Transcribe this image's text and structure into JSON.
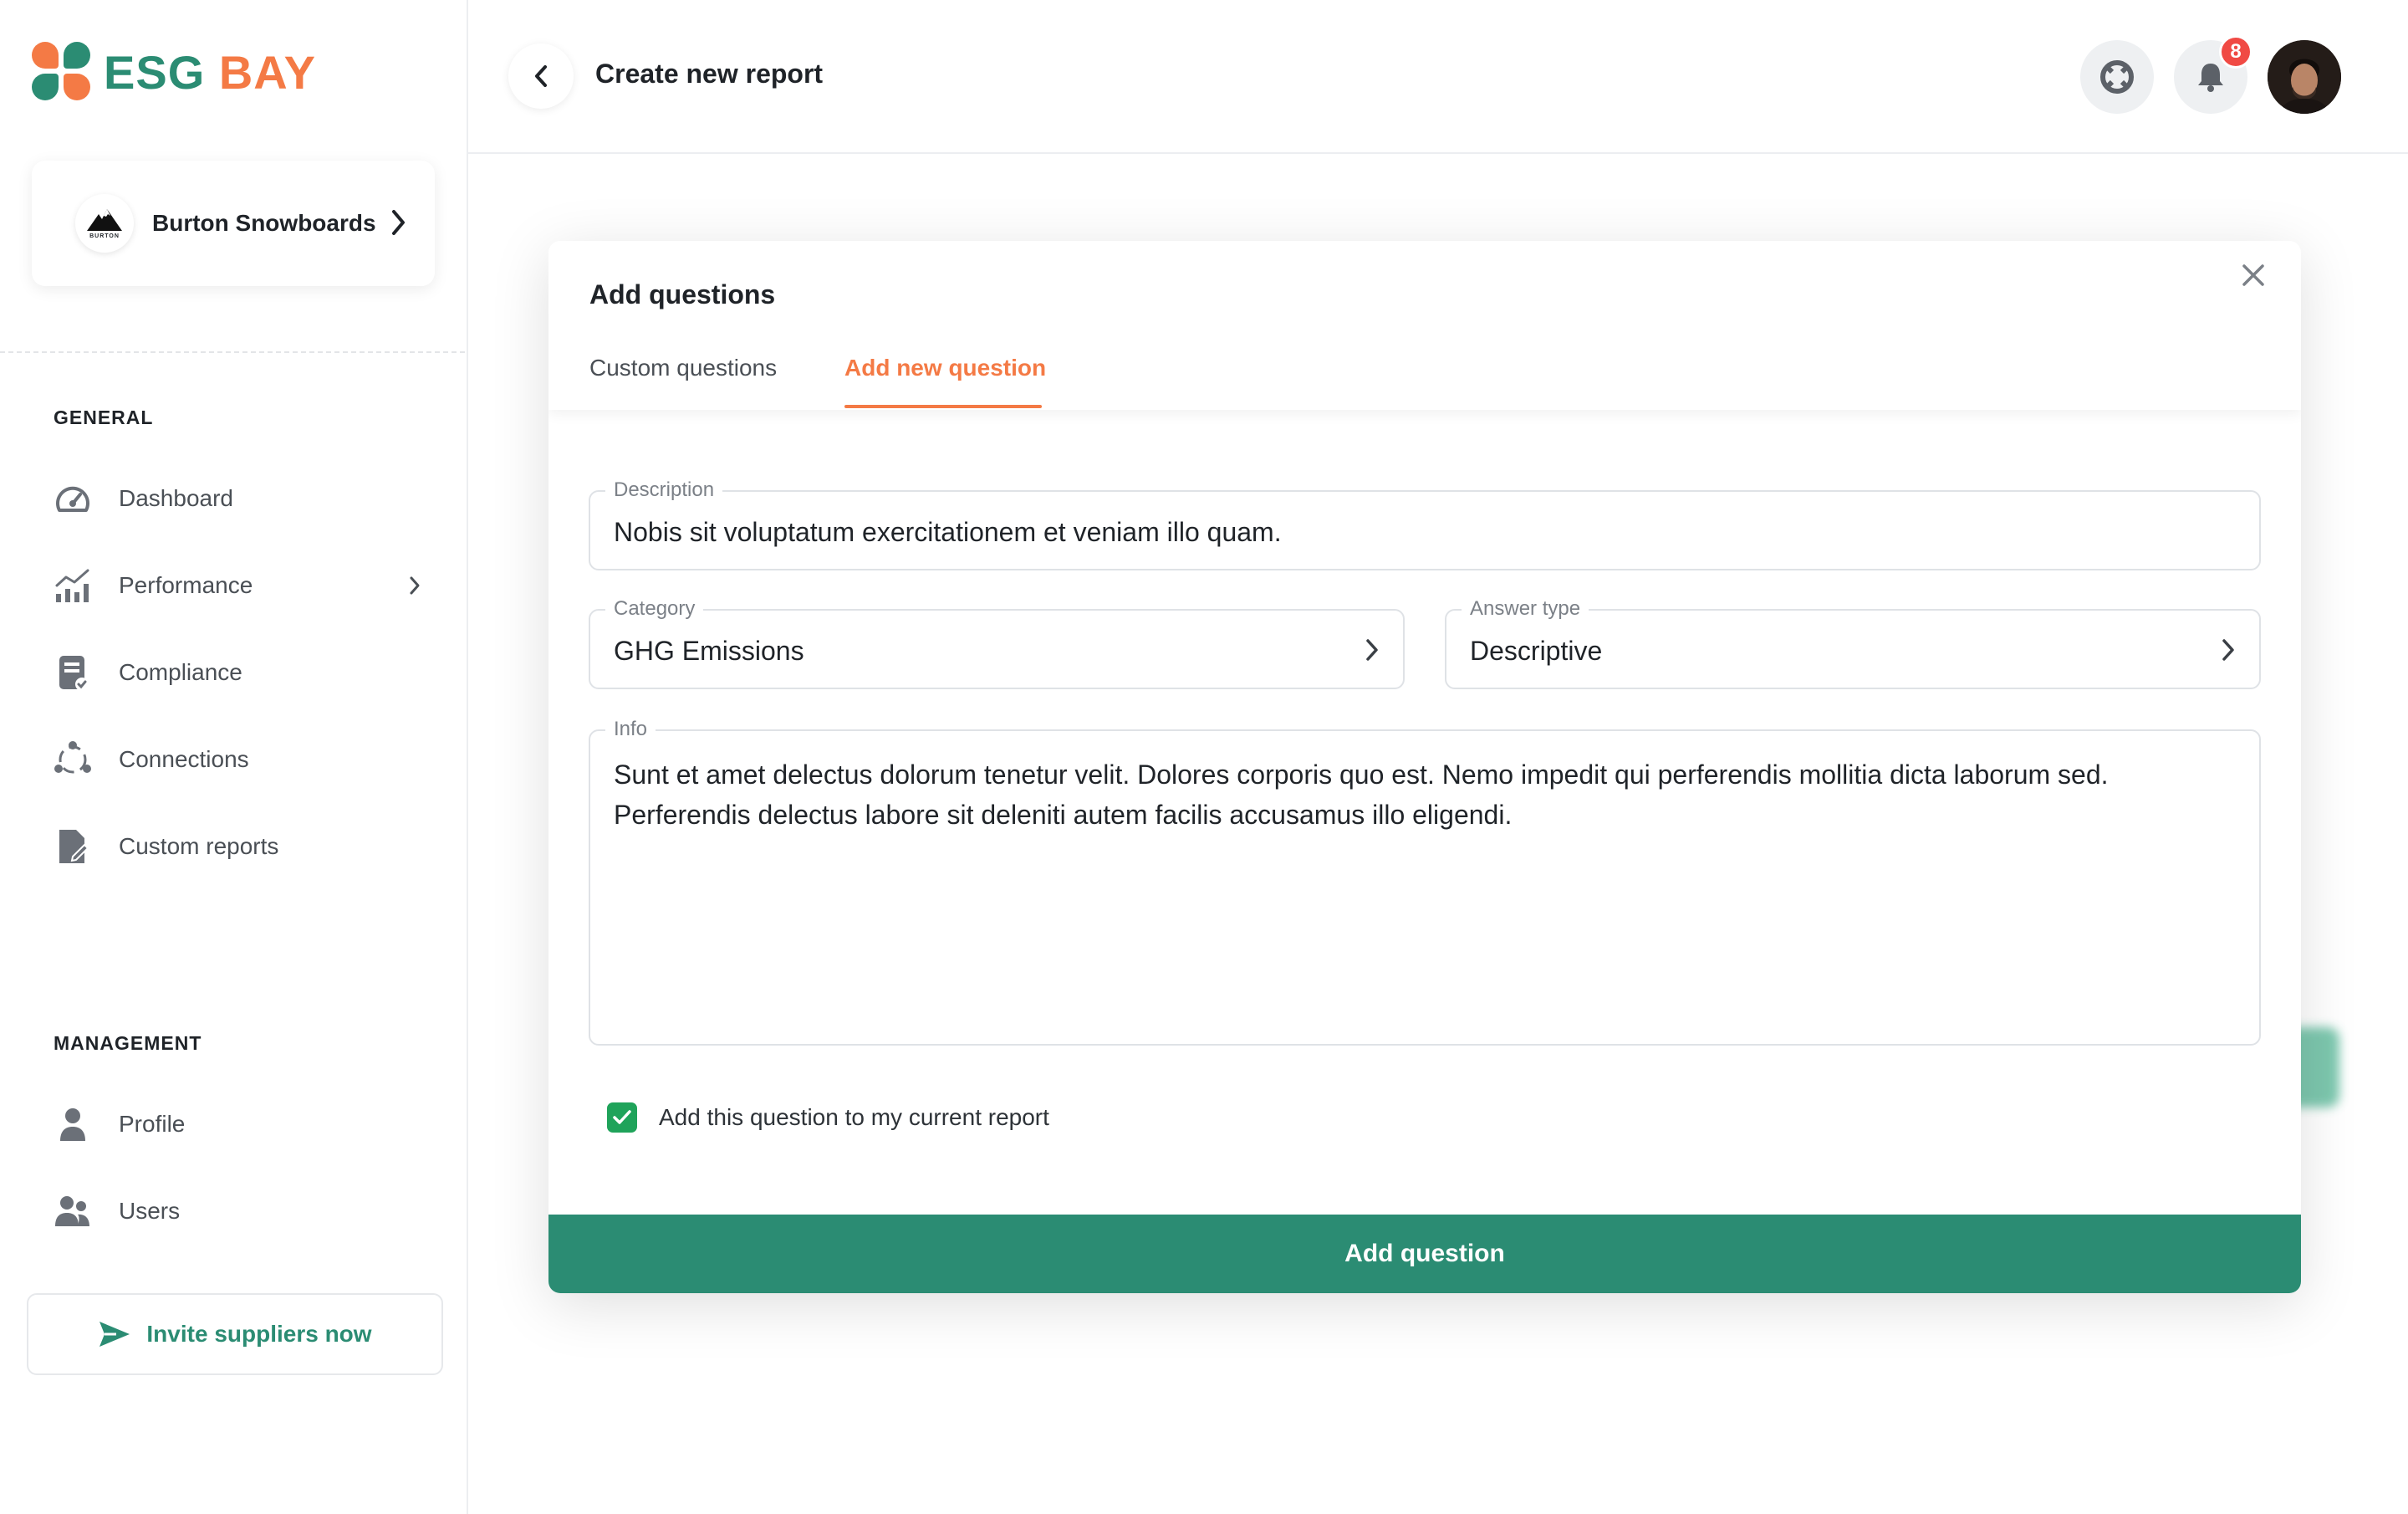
{
  "brand": {
    "part1": "ESG",
    "part2": "BAY"
  },
  "organization": {
    "name": "Burton Snowboards",
    "logo_text": "BURTON"
  },
  "sidebar": {
    "general_title": "GENERAL",
    "general_items": [
      {
        "label": "Dashboard",
        "icon": "gauge-icon"
      },
      {
        "label": "Performance",
        "icon": "bar-chart-icon"
      },
      {
        "label": "Compliance",
        "icon": "clipboard-check-icon"
      },
      {
        "label": "Connections",
        "icon": "network-icon"
      },
      {
        "label": "Custom reports",
        "icon": "document-edit-icon"
      }
    ],
    "management_title": "MANAGEMENT",
    "management_items": [
      {
        "label": "Profile",
        "icon": "user-icon"
      },
      {
        "label": "Users",
        "icon": "users-icon"
      }
    ],
    "invite_label": "Invite suppliers now"
  },
  "header": {
    "title": "Create new report",
    "notification_count": "8"
  },
  "modal": {
    "title": "Add questions",
    "tabs": [
      {
        "label": "Custom questions",
        "active": false
      },
      {
        "label": "Add new question",
        "active": true
      }
    ],
    "description": {
      "label": "Description",
      "value": "Nobis sit voluptatum exercitationem et veniam illo quam."
    },
    "category": {
      "label": "Category",
      "value": "GHG Emissions"
    },
    "answer_type": {
      "label": "Answer type",
      "value": "Descriptive"
    },
    "info": {
      "label": "Info",
      "value": "Sunt et amet delectus dolorum tenetur velit. Dolores corporis quo est. Nemo impedit qui perferendis mollitia dicta laborum sed. Perferendis delectus labore sit deleniti autem facilis accusamus illo eligendi."
    },
    "checkbox": {
      "label": "Add this question to my current report",
      "checked": true
    },
    "submit_label": "Add question"
  },
  "colors": {
    "brand_green": "#2b8c73",
    "brand_orange": "#f47a45",
    "badge_red": "#f04a44",
    "check_green": "#1fa35a"
  }
}
